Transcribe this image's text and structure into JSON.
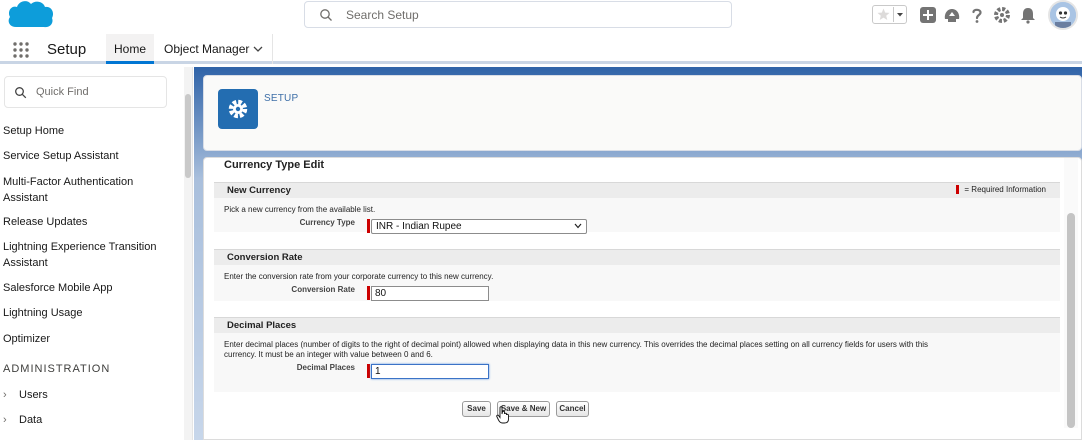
{
  "header": {
    "search_placeholder": "Search Setup",
    "icons": [
      "salesforce-logo",
      "search-icon",
      "star-icon",
      "chevron-down-icon",
      "plus-icon",
      "trailhead-icon",
      "help-icon",
      "gear-icon",
      "bell-icon",
      "avatar"
    ],
    "brand_color": "#0d9dda"
  },
  "context": {
    "app_name": "Setup",
    "tabs": [
      {
        "label": "Home",
        "active": true
      },
      {
        "label": "Object Manager",
        "active": false
      }
    ]
  },
  "sidebar": {
    "quick_find_placeholder": "Quick Find",
    "items": [
      {
        "label": "Setup Home"
      },
      {
        "label": "Service Setup Assistant"
      },
      {
        "label": "Multi-Factor Authentication Assistant"
      },
      {
        "label": "Release Updates"
      },
      {
        "label": "Lightning Experience Transition Assistant"
      },
      {
        "label": "Salesforce Mobile App"
      },
      {
        "label": "Lightning Usage"
      },
      {
        "label": "Optimizer"
      }
    ],
    "section_title": "ADMINISTRATION",
    "tree": [
      {
        "label": "Users"
      },
      {
        "label": "Data"
      }
    ]
  },
  "setup_header": {
    "label": "SETUP"
  },
  "form": {
    "title": "Currency Type Edit",
    "required_info": "= Required Information",
    "sections": {
      "new_currency": {
        "title": "New Currency",
        "desc": "Pick a new currency from the available list.",
        "field_label": "Currency Type",
        "value": "INR - Indian Rupee"
      },
      "conversion_rate": {
        "title": "Conversion Rate",
        "desc": "Enter the conversion rate from your corporate currency to this new currency.",
        "field_label": "Conversion Rate",
        "value": "80"
      },
      "decimal_places": {
        "title": "Decimal Places",
        "desc_line1": "Enter decimal places (number of digits to the right of decimal point) allowed when displaying data in this new currency. This overrides the decimal places setting on all currency fields for users with this",
        "desc_line2": "currency. It must be an integer with value between 0 and 6.",
        "field_label": "Decimal Places",
        "value": "1"
      }
    },
    "buttons": {
      "save": "Save",
      "save_new": "Save & New",
      "cancel": "Cancel"
    }
  }
}
